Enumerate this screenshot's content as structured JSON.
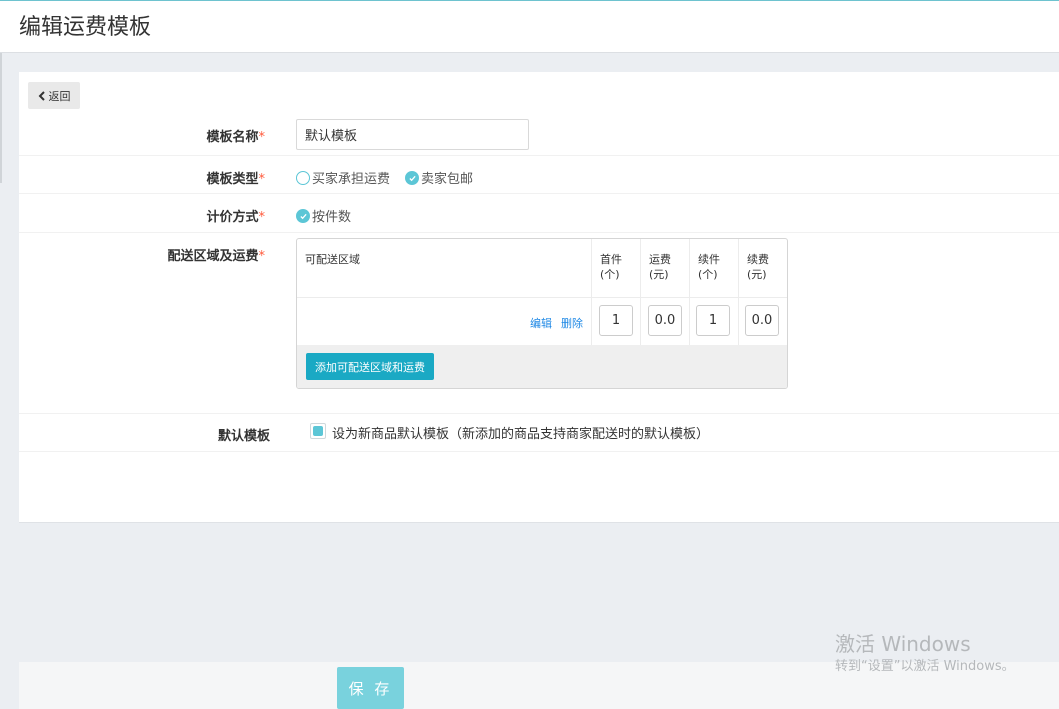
{
  "header": {
    "title": "编辑运费模板"
  },
  "back_button": {
    "label": "返回",
    "icon": "chevron-left-icon"
  },
  "form": {
    "required_mark": "*",
    "template_name": {
      "label": "模板名称",
      "value": "默认模板"
    },
    "template_type": {
      "label": "模板类型",
      "options": [
        {
          "label": "买家承担运费",
          "checked": false
        },
        {
          "label": "卖家包邮",
          "checked": true
        }
      ]
    },
    "pricing_method": {
      "label": "计价方式",
      "options": [
        {
          "label": "按件数",
          "checked": true
        }
      ]
    },
    "delivery": {
      "label": "配送区域及运费",
      "columns": [
        "可配送区域",
        "首件\n(个)",
        "运费\n(元)",
        "续件\n(个)",
        "续费\n(元)"
      ],
      "rows": [
        {
          "region": "",
          "edit": "编辑",
          "delete": "删除",
          "first_qty": "1",
          "first_fee": "0.0",
          "extra_qty": "1",
          "extra_fee": "0.0"
        }
      ],
      "add_button": "添加可配送区域和运费"
    },
    "default_template": {
      "label": "默认模板",
      "checked": true,
      "text": "设为新商品默认模板（新添加的商品支持商家配送时的默认模板）"
    }
  },
  "footer": {
    "save_button": "保 存"
  },
  "watermark": {
    "title": "激活 Windows",
    "subtitle": "转到“设置”以激活 Windows。"
  },
  "colors": {
    "accent": "#5cc6d6",
    "button": "#1aa9c4",
    "link": "#1e88e5",
    "required": "#ff5a3c"
  }
}
